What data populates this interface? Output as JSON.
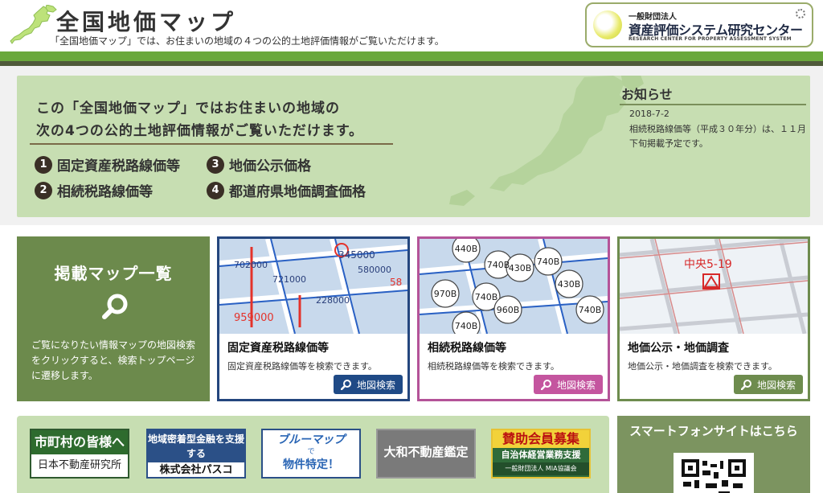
{
  "header": {
    "title": "全国地価マップ",
    "subtitle": "「全国地価マップ」では、お住まいの地域の４つの公的土地評価情報がご覧いただけます。",
    "org_small": "一般財団法人",
    "org_name": "資産評価システム研究センター",
    "org_en": "RESEARCH CENTER FOR PROPERTY ASSESSMENT SYSTEM"
  },
  "hero": {
    "line1": "この「全国地価マップ」ではお住まいの地域の",
    "line2": "次の4つの公的土地評価情報がご覧いただけます。",
    "items": [
      {
        "num": "1",
        "label": "固定資産税路線価等"
      },
      {
        "num": "3",
        "label": "地価公示価格"
      },
      {
        "num": "2",
        "label": "相続税路線価等"
      },
      {
        "num": "4",
        "label": "都道府県地価調査価格"
      }
    ]
  },
  "news": {
    "title": "お知らせ",
    "date": "2018-7-2",
    "text": "相続税路線価等（平成３０年分）は、１１月下旬掲載予定です。"
  },
  "map_list": {
    "title": "掲載マップ一覧",
    "text": "ご覧になりたい情報マップの地図検索をクリックすると、検索トップページに遷移します。"
  },
  "cards": [
    {
      "title": "固定資産税路線価等",
      "desc": "固定資産税路線価等を検索できます。",
      "button": "地図検索"
    },
    {
      "title": "相続税路線価等",
      "desc": "相続税路線価等を検索できます。",
      "button": "地図検索"
    },
    {
      "title": "地価公示・地価調査",
      "desc": "地価公示・地価調査を検索できます。",
      "button": "地図検索"
    }
  ],
  "map_labels": {
    "c1": [
      "702000",
      "345000",
      "721000",
      "580000",
      "58",
      "228000",
      "959000"
    ],
    "c2": [
      "440B",
      "740B",
      "430B",
      "740B",
      "970B",
      "740B",
      "430B",
      "960B",
      "740B",
      "740B"
    ],
    "c3": [
      "中央5-19"
    ]
  },
  "banners": {
    "b1_top": "市町村の皆様へ",
    "b1_bot": "日本不動産研究所",
    "b2_top": "地域密着型金融を支援する",
    "b2_bot": "株式会社パスコ",
    "b3_a": "ブルーマップ",
    "b3_b": "で",
    "b3_c": "物件特定！",
    "b4": "大和不動産鑑定",
    "b5_a": "賛助会員募集",
    "b5_b": "自治体経営業務支援",
    "b5_c": "一般財団法人 MIA協議会"
  },
  "smart": {
    "title": "スマートフォンサイトはこちら"
  },
  "colors": {
    "green": "#6aa83c",
    "blue": "#1f4a86",
    "pink": "#c4559f",
    "olive": "#6e8c4e"
  }
}
